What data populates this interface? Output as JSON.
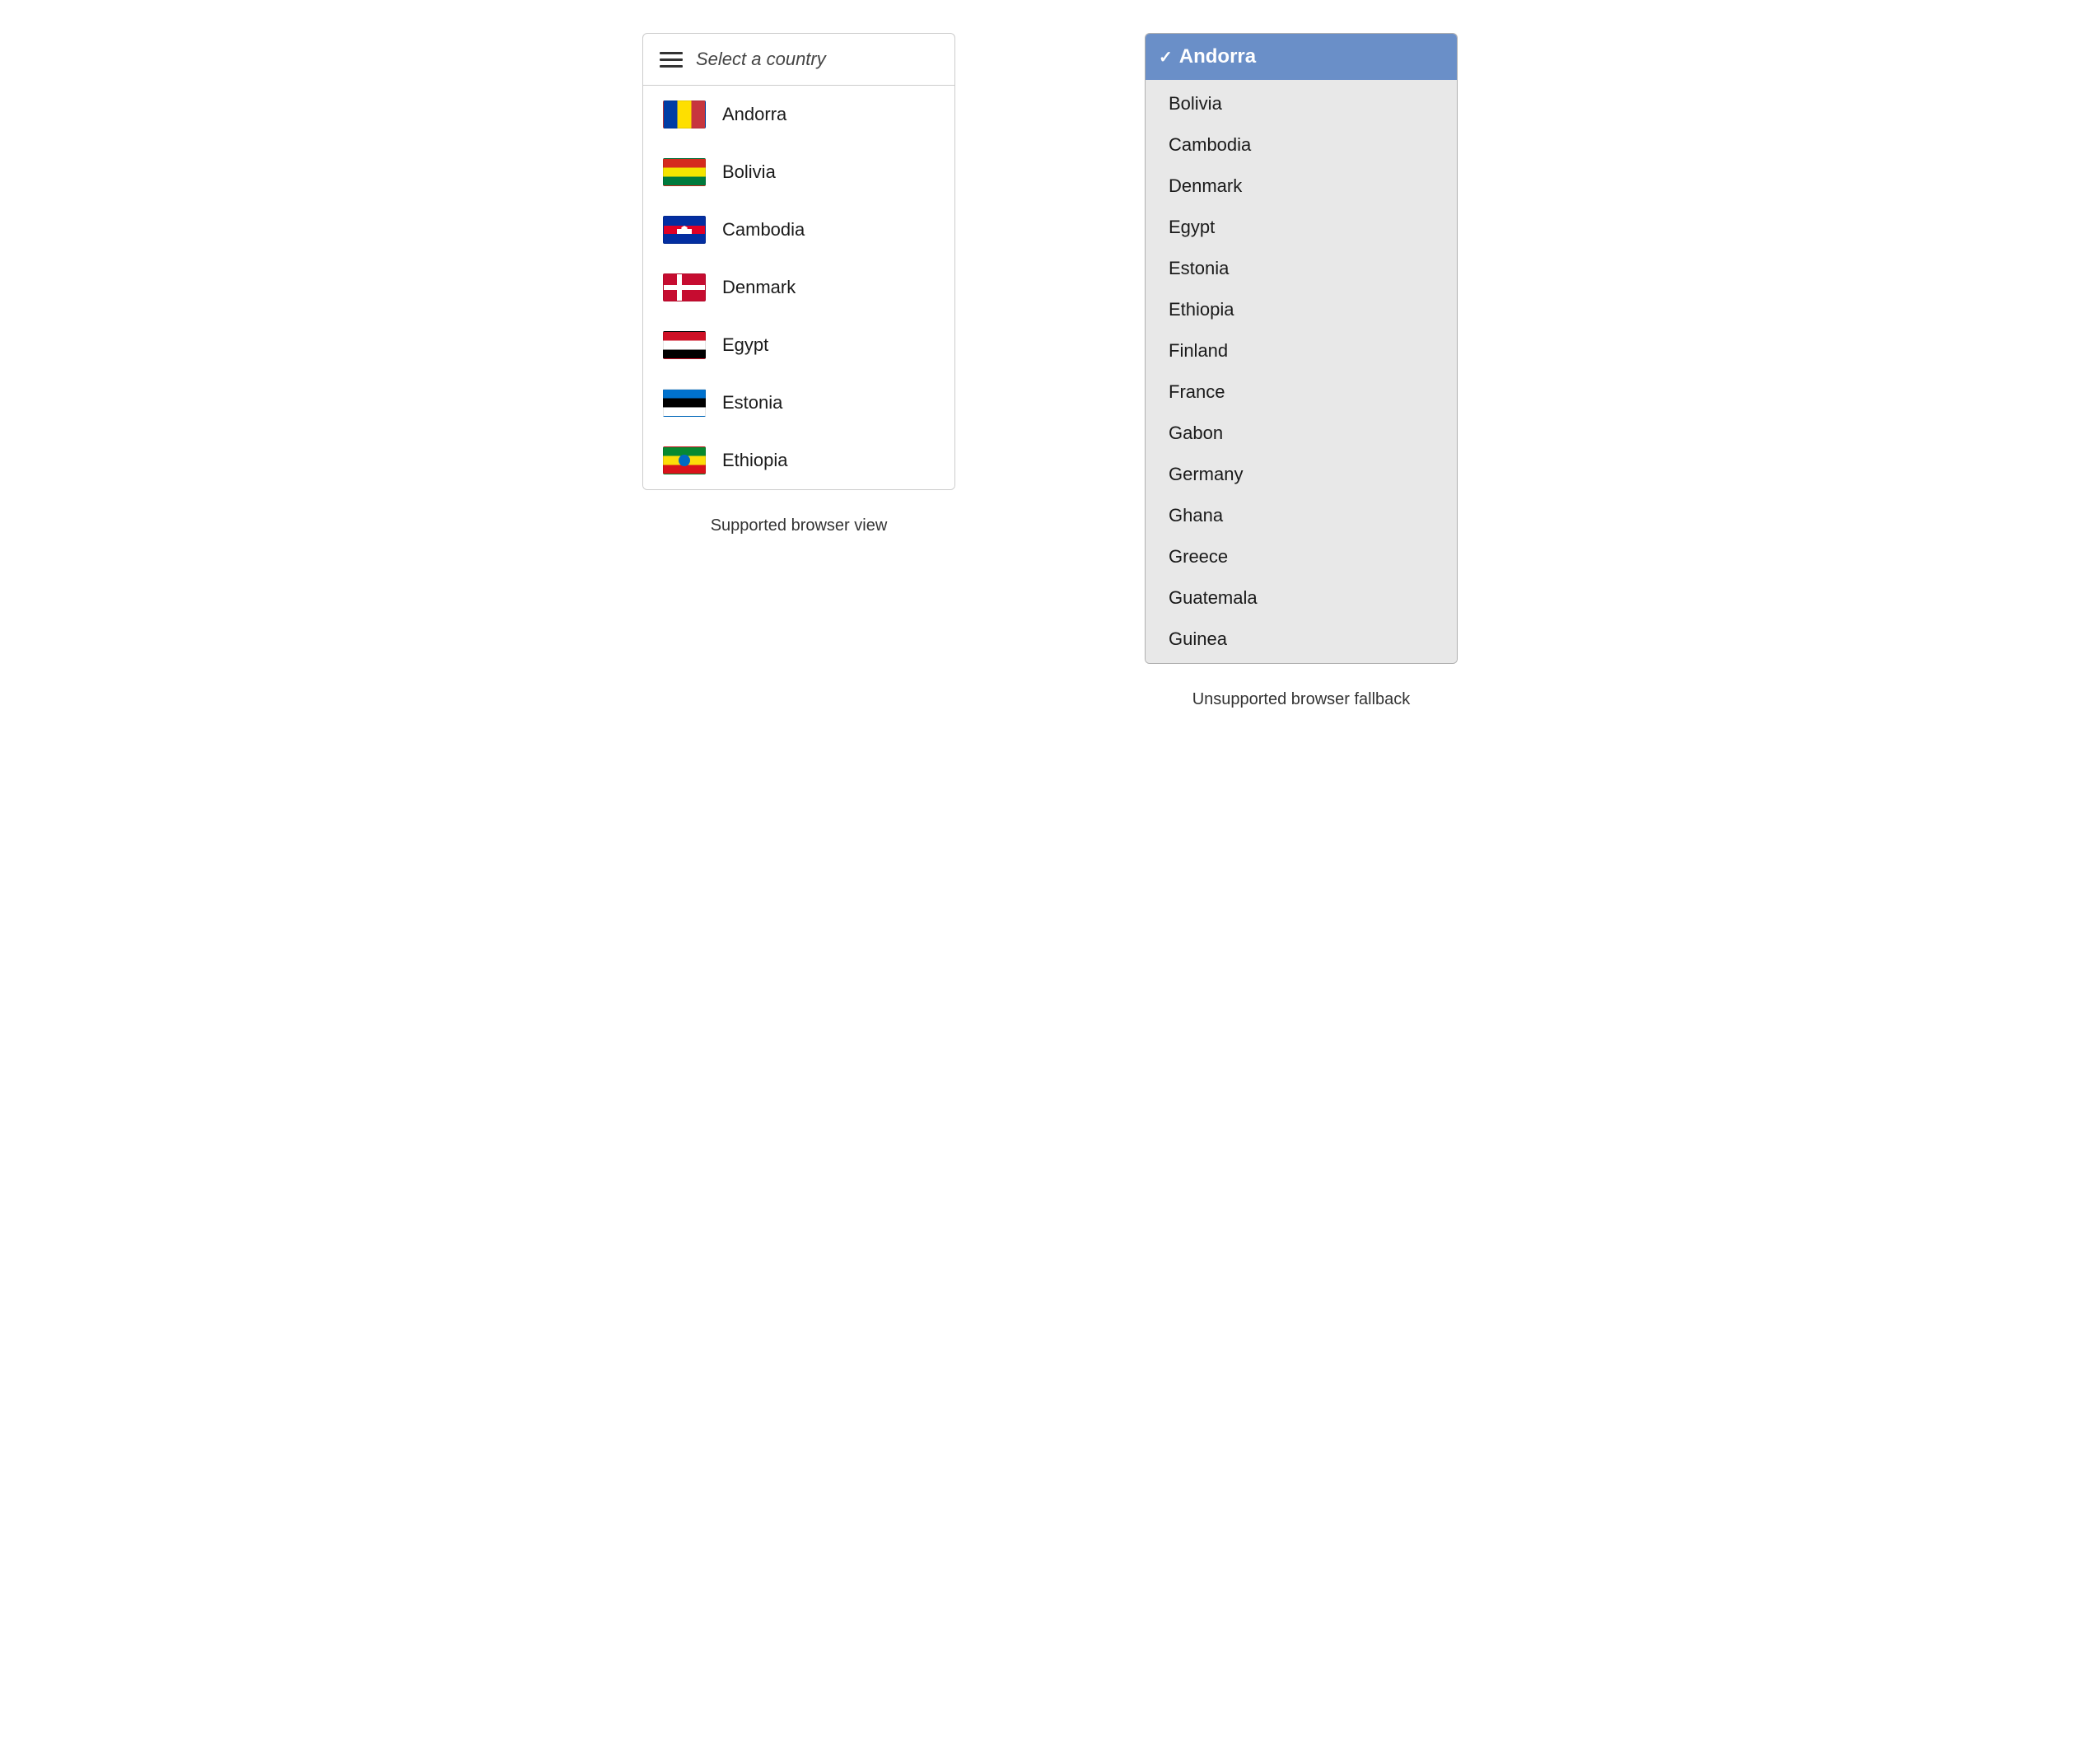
{
  "left": {
    "placeholder": "Select a country",
    "label": "Supported browser view",
    "countries": [
      {
        "id": "ad",
        "name": "Andorra",
        "flag_class": "flag-ad"
      },
      {
        "id": "bo",
        "name": "Bolivia",
        "flag_class": "flag-bo"
      },
      {
        "id": "kh",
        "name": "Cambodia",
        "flag_class": "flag-kh"
      },
      {
        "id": "dk",
        "name": "Denmark",
        "flag_class": "flag-dk"
      },
      {
        "id": "eg",
        "name": "Egypt",
        "flag_class": "flag-eg"
      },
      {
        "id": "ee",
        "name": "Estonia",
        "flag_class": "flag-ee"
      },
      {
        "id": "et",
        "name": "Ethiopia",
        "flag_class": "flag-et"
      }
    ]
  },
  "right": {
    "label": "Unsupported browser fallback",
    "selected": "Andorra",
    "countries": [
      "Bolivia",
      "Cambodia",
      "Denmark",
      "Egypt",
      "Estonia",
      "Ethiopia",
      "Finland",
      "France",
      "Gabon",
      "Germany",
      "Ghana",
      "Greece",
      "Guatemala",
      "Guinea"
    ]
  },
  "icons": {
    "hamburger": "☰",
    "checkmark": "✓"
  }
}
